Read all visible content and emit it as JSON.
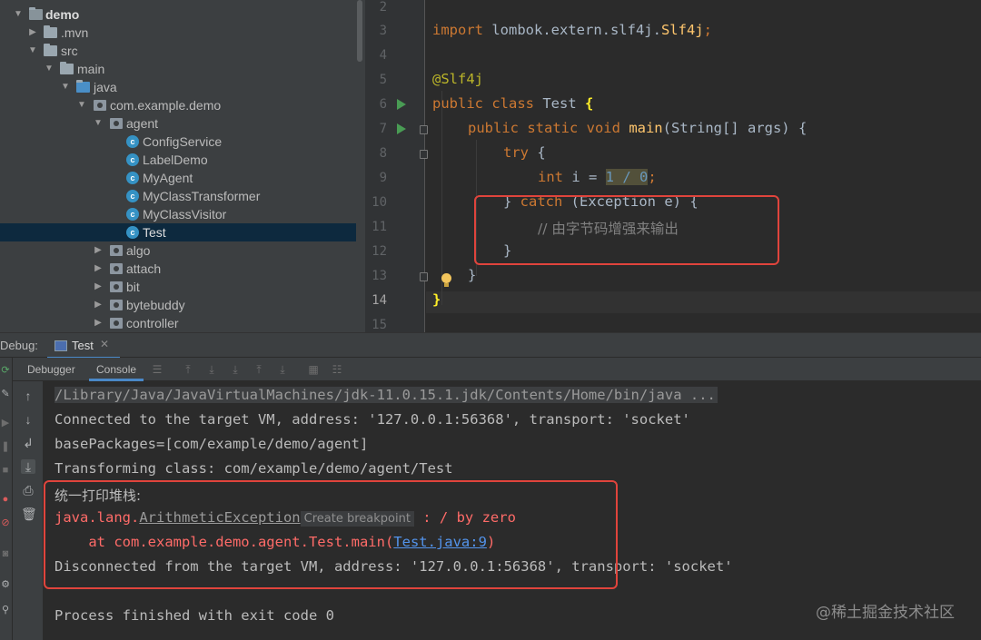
{
  "project_tree": {
    "items": [
      {
        "label": "demo",
        "kind": "module",
        "expanded": true
      },
      {
        "label": ".mvn",
        "kind": "folder",
        "expanded": false
      },
      {
        "label": "src",
        "kind": "folder",
        "expanded": true
      },
      {
        "label": "main",
        "kind": "folder",
        "expanded": true
      },
      {
        "label": "java",
        "kind": "source-folder",
        "expanded": true
      },
      {
        "label": "com.example.demo",
        "kind": "package",
        "expanded": true
      },
      {
        "label": "agent",
        "kind": "package",
        "expanded": true
      },
      {
        "label": "ConfigService",
        "kind": "class"
      },
      {
        "label": "LabelDemo",
        "kind": "class"
      },
      {
        "label": "MyAgent",
        "kind": "class"
      },
      {
        "label": "MyClassTransformer",
        "kind": "class"
      },
      {
        "label": "MyClassVisitor",
        "kind": "class"
      },
      {
        "label": "Test",
        "kind": "class",
        "selected": true
      },
      {
        "label": "algo",
        "kind": "package",
        "expanded": false
      },
      {
        "label": "attach",
        "kind": "package",
        "expanded": false
      },
      {
        "label": "bit",
        "kind": "package",
        "expanded": false
      },
      {
        "label": "bytebuddy",
        "kind": "package",
        "expanded": false
      },
      {
        "label": "controller",
        "kind": "package",
        "expanded": false
      }
    ]
  },
  "editor": {
    "line_numbers": [
      "2",
      "3",
      "4",
      "5",
      "6",
      "7",
      "8",
      "9",
      "10",
      "11",
      "12",
      "13",
      "14",
      "15"
    ],
    "current_line": "14",
    "code": {
      "l3_import": "import",
      "l3_pkg": " lombok.extern.slf4j.",
      "l3_cls": "Slf4j",
      "l3_semi": ";",
      "l5_ann": "@Slf4j",
      "l6_public": "public",
      "l6_class": " class",
      "l6_name": " Test ",
      "l6_brace": "{",
      "l7_mods": "public static void",
      "l7_name": " main",
      "l7_rest": "(String[] args) {",
      "l8_try": "try",
      "l8_rest": " {",
      "l9_int": "int",
      "l9_i": " i = ",
      "l9_expr": "1 / 0",
      "l9_semi": ";",
      "l10_close": "} ",
      "l10_catch": "catch",
      "l10_rest": " (Exception e) {",
      "l11_comment": "// 由字节码增强来输出",
      "l12_close": "}",
      "l13_close": "}",
      "l14_close": "}"
    }
  },
  "debug": {
    "label": "Debug:",
    "tab_label": "Test",
    "tabs": [
      "Debugger",
      "Console"
    ],
    "active_tab": "Console"
  },
  "console": {
    "lines": {
      "cmd": "/Library/Java/JavaVirtualMachines/jdk-11.0.15.1.jdk/Contents/Home/bin/java ...",
      "connected": "Connected to the target VM, address: '127.0.0.1:56368', transport: 'socket'",
      "packages": "basePackages=[com/example/demo/agent]",
      "transforming": "Transforming class: com/example/demo/agent/Test",
      "stack_header": "统一打印堆栈:",
      "exc_prefix": "java.lang.",
      "exc_name": "ArithmeticException",
      "bp_hint": "Create breakpoint",
      "exc_msg": " : / by zero",
      "at_prefix": "    at com.example.demo.agent.Test.main(",
      "at_link": "Test.java:9",
      "at_suffix": ")",
      "disconnected": "Disconnected from the target VM, address: '127.0.0.1:56368', transport: 'socket'",
      "finished": "Process finished with exit code 0"
    }
  },
  "watermark": "@稀土掘金技术社区",
  "colors": {
    "highlight_box": "#e0443c",
    "error_text": "#ff6b68",
    "link": "#5394ec",
    "selection": "#0d293e"
  }
}
